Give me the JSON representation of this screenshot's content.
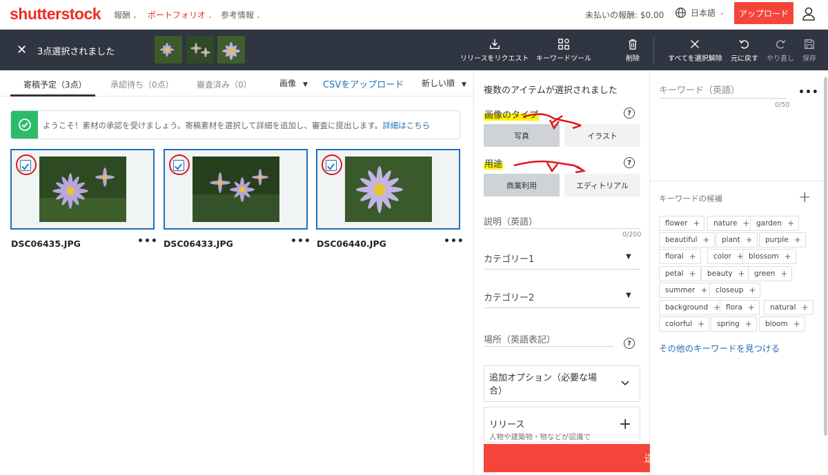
{
  "header": {
    "logo": "shutterstock",
    "nav": [
      {
        "label": "報酬",
        "active": false
      },
      {
        "label": "ポートフォリオ",
        "active": true
      },
      {
        "label": "参考情報",
        "active": false
      }
    ],
    "earnings": "未払いの報酬: $0.00",
    "language": "日本語",
    "upload_label": "アップロード",
    "accent": "#ee2b24"
  },
  "selection_bar": {
    "count_label": "3点選択されました",
    "tools": {
      "release_request": "リリースをリクエスト",
      "keyword_tool": "キーワードツール",
      "delete": "削除",
      "deselect_all": "すべてを選択解除",
      "undo": "元に戻す",
      "redo": "やり直し",
      "save": "保存"
    }
  },
  "tabs": [
    {
      "label": "寄稿予定（3点）"
    },
    {
      "label": "承認待ち（0点）"
    },
    {
      "label": "審査済み（0）"
    }
  ],
  "filters": {
    "type": "画像",
    "csv_upload": "CSVをアップロード",
    "sort": "新しい順"
  },
  "notice": {
    "text": "ようこそ！素材の承認を受けましょう。寄稿素材を選択して詳細を追加し、審査に提出します。",
    "link": "詳細はこちら"
  },
  "assets": [
    {
      "filename": "DSC06435.JPG",
      "more": "•••",
      "selected": true
    },
    {
      "filename": "DSC06433.JPG",
      "more": "•••",
      "selected": true
    },
    {
      "filename": "DSC06440.JPG",
      "more": "•••",
      "selected": true
    }
  ],
  "editor": {
    "title": "複数のアイテムが選択されました",
    "image_type": {
      "label": "画像のタイプ",
      "options": [
        "写真",
        "イラスト"
      ],
      "selected": "写真"
    },
    "usage": {
      "label": "用途",
      "options": [
        "商業利用",
        "エディトリアル"
      ],
      "selected": "商業利用"
    },
    "description": {
      "placeholder": "説明（英語）",
      "counter": "0/200"
    },
    "category1": "カテゴリー1",
    "category2": "カテゴリー2",
    "location": {
      "placeholder": "場所（英語表記）"
    },
    "additional_options": "追加オプション（必要な場合）",
    "release": {
      "title": "リリース",
      "subtitle": "人物や建築物・物などが認識で"
    },
    "submit_label": "送信"
  },
  "keywords": {
    "placeholder": "キーワード（英語）",
    "counter": "0/50",
    "more": "•••",
    "suggestions_label": "キーワードの候補",
    "suggestions": [
      "flower",
      "nature",
      "garden",
      "beautiful",
      "plant",
      "purple",
      "floral",
      "color",
      "blossom",
      "petal",
      "beauty",
      "green",
      "summer",
      "closeup",
      "background",
      "flora",
      "natural",
      "colorful",
      "spring",
      "bloom"
    ],
    "find_more": "その他のキーワードを見つける"
  }
}
